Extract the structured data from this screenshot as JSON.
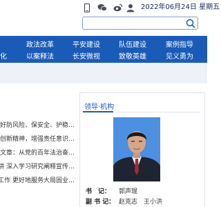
{
  "header": {
    "date": "2022年06月24日 星期五",
    "search": {
      "placeholder": ""
    },
    "icons": [
      "mobile-icon",
      "wechat-icon",
      "weibo-icon",
      "user-icon"
    ]
  },
  "nav": {
    "row1": [
      "政法改革",
      "平安建设",
      "队伍建设",
      "案例指导"
    ],
    "row2": [
      "化",
      "以案释法",
      "长安微视",
      "致敬英雄",
      "见义勇为"
    ]
  },
  "news": [
    "…做好防风险、保安全、护稳…",
    "…锦创新精神，增强责任意识…",
    "名文章：从党的百年法治奋…",
    "…播讲 深入学习研究阐释宣传…",
    "…论工作 更好地服务大局固业…"
  ],
  "leaders": {
    "title": "领导·机构",
    "roles": [
      {
        "label": "书　记：",
        "name": "郭声琨"
      },
      {
        "label": "副 书 记：",
        "name": "赵克志　王小洪"
      }
    ]
  },
  "colors": {
    "brand": "#1a5bb8",
    "subbar": "#eef2f8",
    "panel_border": "#dfe3ea"
  }
}
